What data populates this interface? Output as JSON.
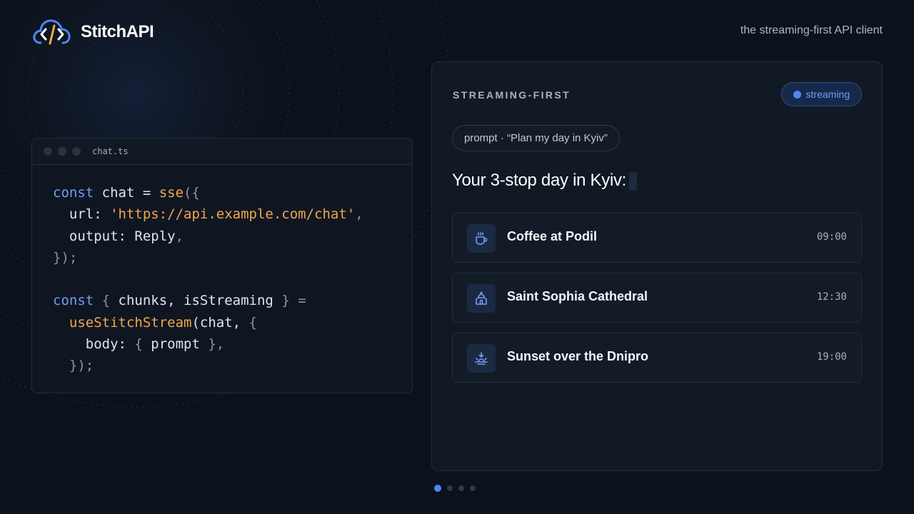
{
  "brand": {
    "name": "StitchAPI",
    "tagline": "the streaming-first API client"
  },
  "colors": {
    "accent": "#4f86f0",
    "code_string": "#f2a848",
    "code_keyword": "#6f9ef5",
    "background": "#0c121c"
  },
  "editor": {
    "filename": "chat.ts",
    "code": {
      "l1_kw": "const",
      "l1_var": " chat = ",
      "l1_fn": "sse",
      "l1_punc": "({",
      "l2_key": "  url: ",
      "l2_str": "'https://api.example.com/chat'",
      "l2_punc": ",",
      "l3_key": "  output: ",
      "l3_val": "Reply",
      "l3_punc": ",",
      "l4": "});",
      "l6_kw": "const",
      "l6_punc1": " { ",
      "l6_vars": "chunks, isStreaming",
      "l6_punc2": " } =",
      "l7_fn": "  useStitchStream",
      "l7_rest": "(chat, ",
      "l7_punc": "{",
      "l8_key": "    body: ",
      "l8_punc1": "{ ",
      "l8_val": "prompt",
      "l8_punc2": " },",
      "l9": "  });"
    }
  },
  "panel": {
    "title": "STREAMING-FIRST",
    "badge": "streaming",
    "prompt": "prompt · “Plan my day in Kyiv”",
    "heading": "Your 3-stop day in Kyiv:",
    "stops": [
      {
        "name": "Coffee at Podil",
        "time": "09:00",
        "icon": "coffee-cup-icon"
      },
      {
        "name": "Saint Sophia Cathedral",
        "time": "12:30",
        "icon": "cathedral-icon"
      },
      {
        "name": "Sunset over the Dnipro",
        "time": "19:00",
        "icon": "sunset-icon"
      }
    ]
  },
  "pager": {
    "count": 4,
    "active_index": 0
  }
}
